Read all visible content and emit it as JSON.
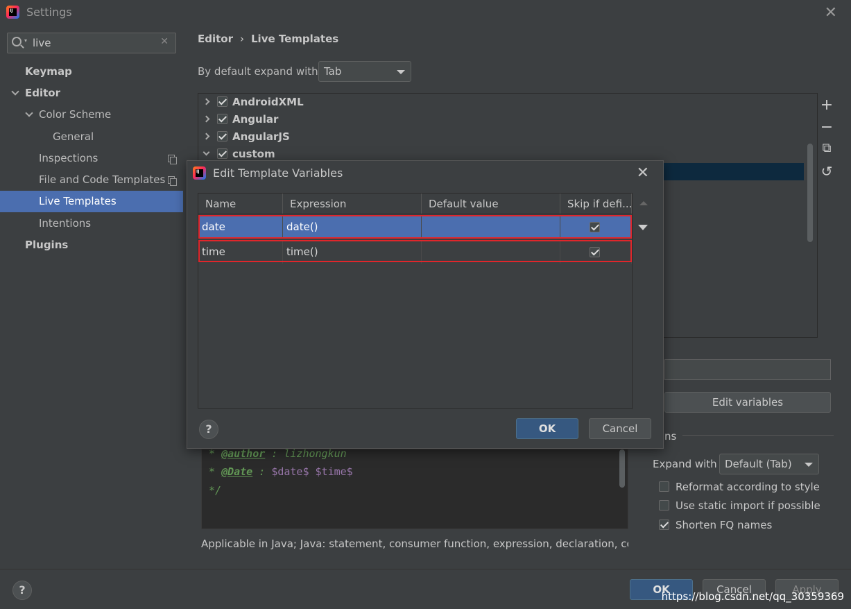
{
  "window": {
    "title": "Settings"
  },
  "search": {
    "value": "live"
  },
  "sidebar": {
    "items": [
      {
        "label": "Keymap"
      },
      {
        "label": "Editor"
      },
      {
        "label": "Color Scheme"
      },
      {
        "label": "General"
      },
      {
        "label": "Inspections"
      },
      {
        "label": "File and Code Templates"
      },
      {
        "label": "Live Templates"
      },
      {
        "label": "Intentions"
      },
      {
        "label": "Plugins"
      }
    ]
  },
  "breadcrumb": {
    "part1": "Editor",
    "sep": "›",
    "part2": "Live Templates"
  },
  "expand": {
    "label": "By default expand with",
    "value": "Tab"
  },
  "template_groups": [
    {
      "label": "AndroidXML",
      "checked": true
    },
    {
      "label": "Angular",
      "checked": true
    },
    {
      "label": "AngularJS",
      "checked": true
    },
    {
      "label": "custom",
      "checked": true
    }
  ],
  "toolbar": {
    "add": "+",
    "remove": "−",
    "copy": "⧉",
    "revert": "↺"
  },
  "edit_variables_label": "Edit variables",
  "options": {
    "section_label": "ns",
    "expand_with_label": "Expand with",
    "expand_with_value": "Default (Tab)",
    "reformat": {
      "label": "Reformat according to style",
      "checked": false
    },
    "static_import": {
      "label": "Use static import if possible",
      "checked": false
    },
    "shorten_fq": {
      "label": "Shorten FQ names",
      "checked": true
    }
  },
  "code": {
    "line1": {
      "star": "* ",
      "tag": "@author",
      "rest": " : lizhongkun"
    },
    "line2": {
      "star": "* ",
      "tag": "@Date",
      "rest": " : ",
      "vars": "$date$ $time$"
    },
    "line3": "*/"
  },
  "applicable": "Applicable in Java; Java: statement, consumer function, expression, declaration, comr",
  "footer": {
    "ok": "OK",
    "cancel": "Cancel",
    "apply": "Apply",
    "help": "?"
  },
  "watermark": "https://blog.csdn.net/qq_30359369",
  "dialog": {
    "title": "Edit Template Variables",
    "columns": [
      "Name",
      "Expression",
      "Default value",
      "Skip if defi..."
    ],
    "rows": [
      {
        "name": "date",
        "expression": "date()",
        "default": "",
        "skip": true
      },
      {
        "name": "time",
        "expression": "time()",
        "default": "",
        "skip": true
      }
    ],
    "ok": "OK",
    "cancel": "Cancel",
    "help": "?"
  },
  "colors": {
    "accent": "#4b6eaf",
    "highlight": "#e0262b",
    "background": "#3c3f41"
  }
}
